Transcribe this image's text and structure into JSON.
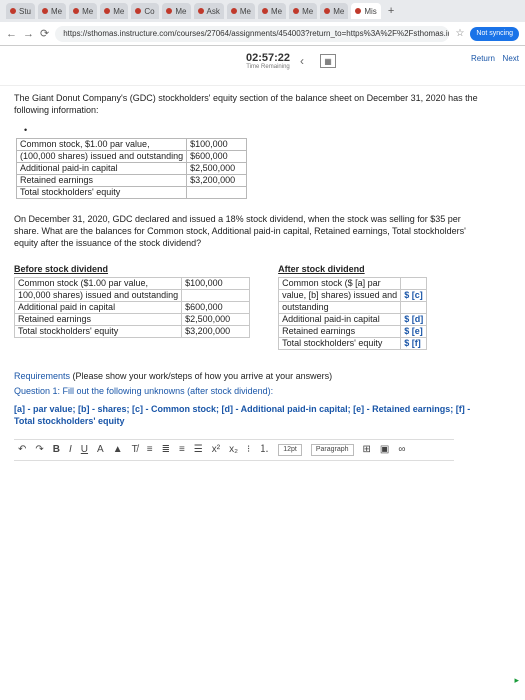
{
  "browser": {
    "tabs": [
      "Stu",
      "Me",
      "Me",
      "Me",
      "Co",
      "Me",
      "Ask",
      "Me",
      "Me",
      "Me",
      "Me",
      "Mis"
    ],
    "url": "https://sthomas.instructure.com/courses/27064/assignments/454003?return_to=https%3A%2F%2Fsthomas.instructure.com%2Fcalen...",
    "profile_label": "Not syncing"
  },
  "quiz_header": {
    "timer": "02:57:22",
    "timer_label": "Time Remaining",
    "return_label": "Return",
    "next_label": "Next"
  },
  "intro": "The Giant Donut Company's (GDC) stockholders' equity section of the balance sheet on December 31, 2020 has the following information:",
  "balance_table": [
    {
      "label": "Common stock, $1.00 par value,",
      "value": "$100,000"
    },
    {
      "label": "(100,000 shares) issued and outstanding",
      "value": "$600,000"
    },
    {
      "label": "Additional paid-in capital",
      "value": "$2,500,000"
    },
    {
      "label": "Retained earnings",
      "value": "$3,200,000"
    },
    {
      "label": "Total stockholders' equity",
      "value": ""
    }
  ],
  "question": "On December 31, 2020, GDC declared and issued a 18% stock dividend, when the stock was selling for $35 per share. What are the balances for Common stock, Additional paid-in capital, Retained earnings, Total stockholders' equity after the issuance of the stock dividend?",
  "before": {
    "heading": "Before stock dividend",
    "rows": [
      {
        "label": "Common stock ($1.00 par value,",
        "value": "$100,000"
      },
      {
        "label": "100,000 shares) issued and outstanding",
        "value": ""
      },
      {
        "label": "Additional paid in capital",
        "value": "$600,000"
      },
      {
        "label": "Retained earnings",
        "value": "$2,500,000"
      },
      {
        "label": "Total stockholders' equity",
        "value": "$3,200,000"
      }
    ]
  },
  "after": {
    "heading": "After stock dividend",
    "rows": [
      {
        "label": "Common stock ($ [a] par",
        "value": ""
      },
      {
        "label": "value, [b] shares) issued and",
        "value": "$ [c]"
      },
      {
        "label": "outstanding",
        "value": ""
      },
      {
        "label": "Additional paid-in capital",
        "value": "$ [d]"
      },
      {
        "label": "Retained earnings",
        "value": "$ [e]"
      },
      {
        "label": "Total stockholders' equity",
        "value": "$ [f]"
      }
    ]
  },
  "requirements": {
    "label": "Requirements",
    "text": " (Please show your work/steps of how you arrive at your answers)",
    "q1": "Question 1: Fill out the following unknowns (after stock dividend):",
    "unknowns": "[a] - par value; [b] - shares; [c] - Common stock; [d] - Additional paid-in capital; [e] - Retained earnings; [f] - Total stockholders' equity"
  },
  "editor": {
    "font_size": "12pt",
    "paragraph": "Paragraph"
  }
}
